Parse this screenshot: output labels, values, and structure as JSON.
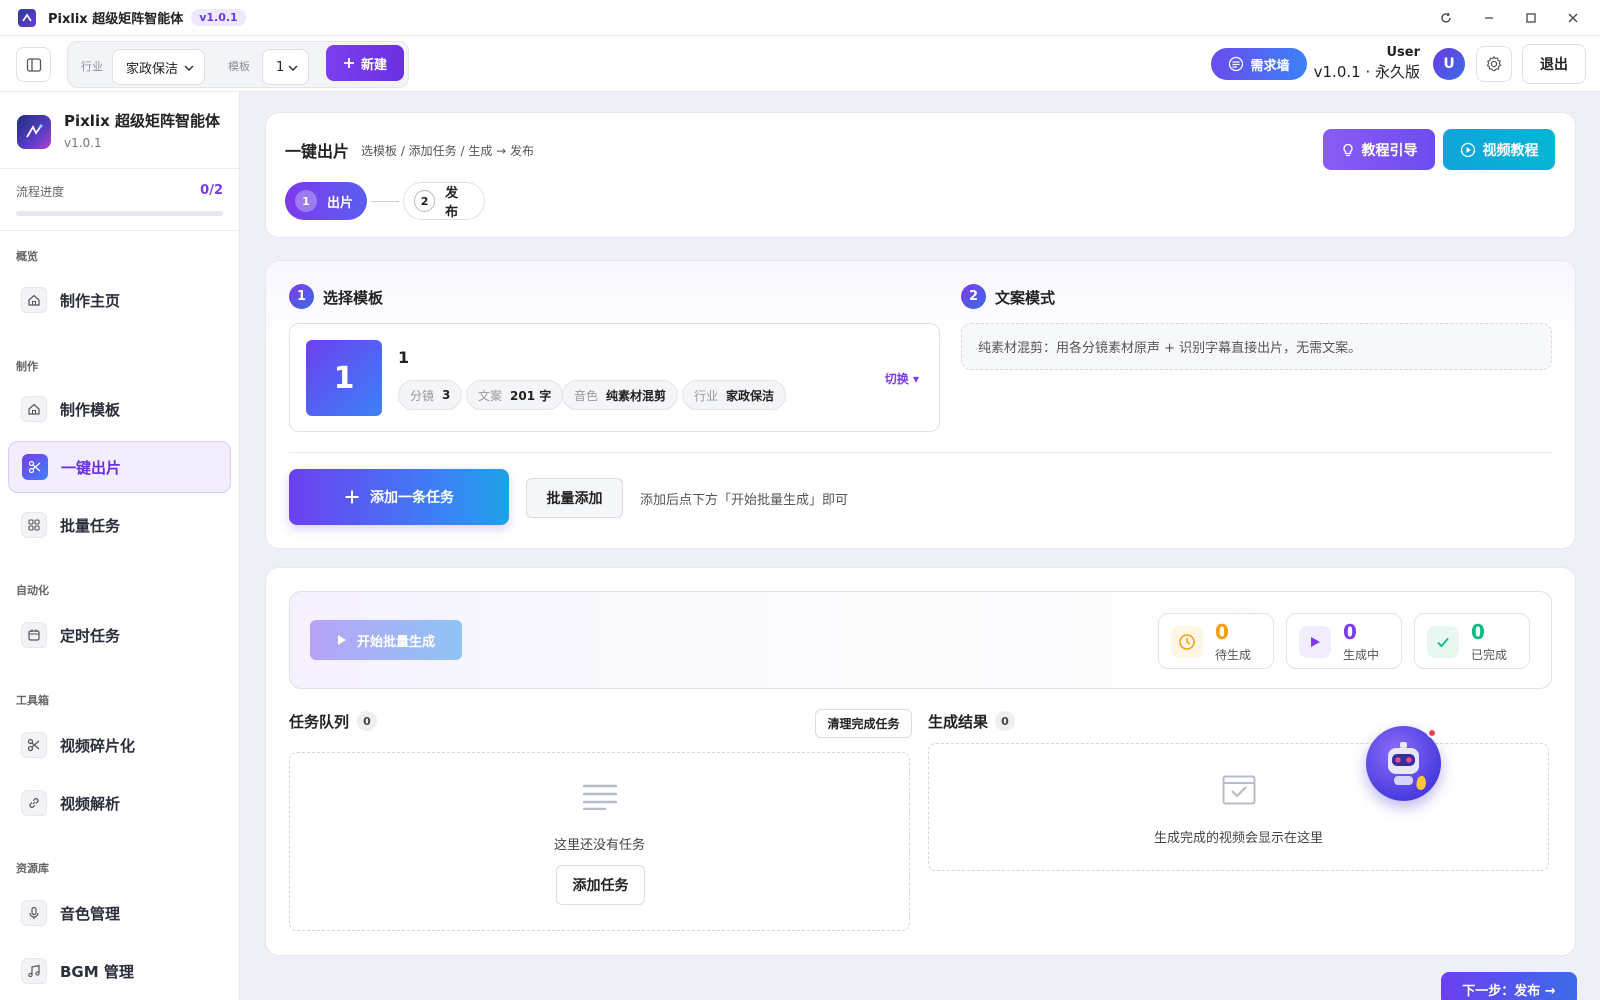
{
  "titlebar": {
    "title": "Pixlix 超级矩阵智能体",
    "version_badge": "v1.0.1"
  },
  "toolbar": {
    "industry_label": "行业",
    "industry_value": "家政保洁",
    "template_label": "模板",
    "template_value": "1",
    "new_label": "新建",
    "request_wall_label": "需求墙",
    "user_name": "User",
    "user_plan": "v1.0.1 · 永久版",
    "avatar_letter": "U",
    "logout_label": "退出"
  },
  "sidebar": {
    "brand_name": "Pixlix 超级矩阵智能体",
    "brand_version": "v1.0.1",
    "progress_label": "流程进度",
    "progress_value": "0/2",
    "progress_fraction": 0.0,
    "sections": {
      "overview": "概览",
      "make": "制作",
      "automation": "自动化",
      "toolbox": "工具箱",
      "library": "资源库"
    },
    "items": [
      {
        "label": "制作主页",
        "icon": "home-icon"
      },
      {
        "label": "制作模板",
        "icon": "home-icon"
      },
      {
        "label": "一键出片",
        "icon": "scissors-icon",
        "active": true
      },
      {
        "label": "批量任务",
        "icon": "grid-icon"
      },
      {
        "label": "定时任务",
        "icon": "calendar-icon"
      },
      {
        "label": "视频碎片化",
        "icon": "scissors-icon"
      },
      {
        "label": "视频解析",
        "icon": "link-icon"
      },
      {
        "label": "音色管理",
        "icon": "mic-icon"
      },
      {
        "label": "BGM 管理",
        "icon": "music-icon"
      }
    ]
  },
  "header": {
    "title": "一键出片",
    "breadcrumb": "选模板 / 添加任务 / 生成 → 发布",
    "steps": [
      {
        "num": "1",
        "label": "出片"
      },
      {
        "num": "2",
        "label": "发布"
      }
    ],
    "tutorial_label": "教程引导",
    "video_tutorial_label": "视频教程"
  },
  "template_section": {
    "num": "1",
    "title": "选择模板",
    "thumb_text": "1",
    "name": "1",
    "chips": [
      {
        "k": "分镜",
        "v": "3"
      },
      {
        "k": "文案",
        "v": "201 字"
      },
      {
        "k": "音色",
        "v": "纯素材混剪"
      },
      {
        "k": "行业",
        "v": "家政保洁"
      }
    ],
    "switch_label": "切换"
  },
  "copy_section": {
    "num": "2",
    "title": "文案模式",
    "description": "纯素材混剪：用各分镜素材原声 + 识别字幕直接出片，无需文案。"
  },
  "task_add": {
    "add_one_label": "添加一条任务",
    "batch_add_label": "批量添加",
    "hint": "添加后点下方「开始批量生成」即可"
  },
  "generation": {
    "start_label": "开始批量生成",
    "stats": [
      {
        "value": "0",
        "label": "待生成",
        "color": "#f59e0b",
        "icon": "clock-icon"
      },
      {
        "value": "0",
        "label": "生成中",
        "color": "#7c3aed",
        "icon": "play-icon"
      },
      {
        "value": "0",
        "label": "已完成",
        "color": "#10b981",
        "icon": "check-icon"
      }
    ]
  },
  "queue": {
    "title": "任务队列",
    "count": "0",
    "clear_label": "清理完成任务",
    "empty_text": "这里还没有任务",
    "add_label": "添加任务"
  },
  "results": {
    "title": "生成结果",
    "count": "0",
    "empty_text": "生成完成的视频会显示在这里"
  },
  "footer": {
    "next_label": "下一步：发布 →"
  },
  "colors": {
    "accent": "#7c3aed",
    "blue": "#3b82f6",
    "cyan": "#06b6d4"
  }
}
